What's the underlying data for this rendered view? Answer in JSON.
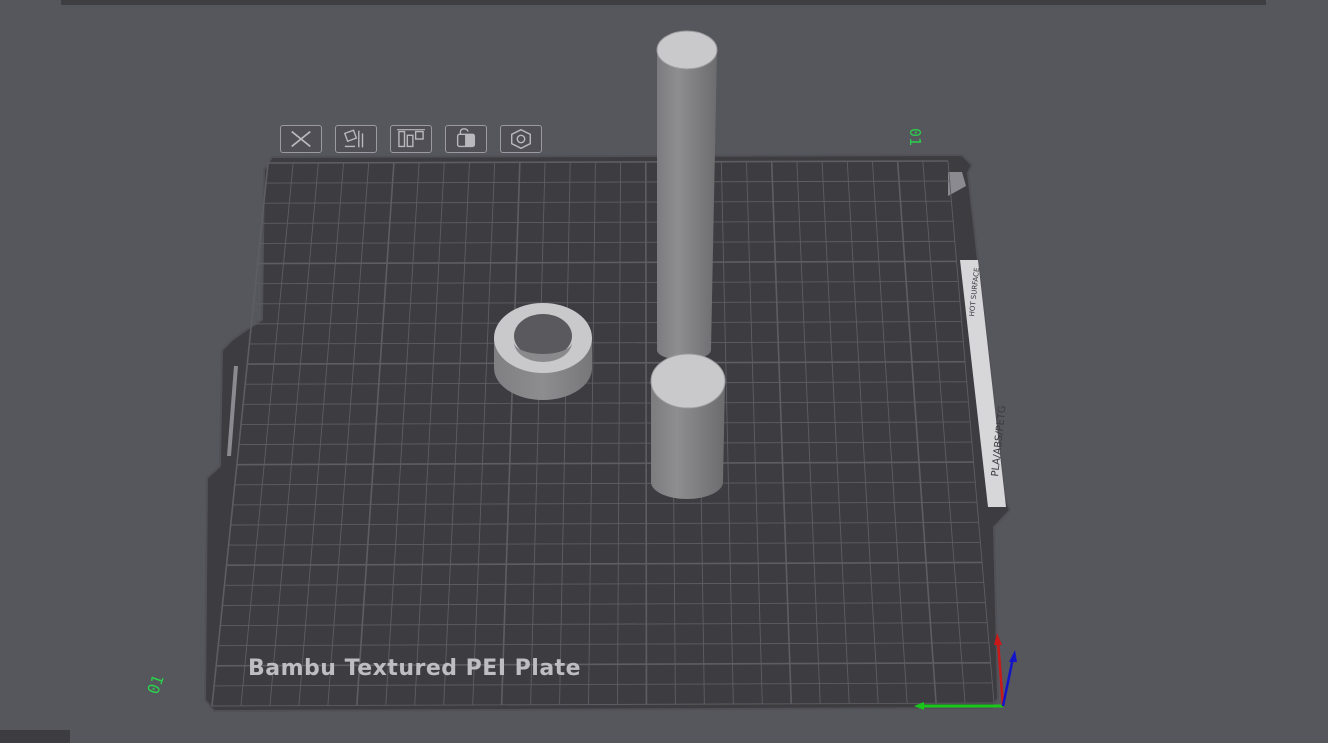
{
  "viewport": {
    "plate_name": "Bambu Textured PEI Plate",
    "plate_index": "01",
    "corner_label": "01",
    "plate_edge_labels": {
      "material": "PLA/ABS/PETG",
      "warning": "HOT SURFACE"
    }
  },
  "plate_toolbar": [
    {
      "name": "delete-all-button",
      "icon": "close-x-icon"
    },
    {
      "name": "auto-orient-button",
      "icon": "auto-orient-icon"
    },
    {
      "name": "arrange-button",
      "icon": "arrange-icon"
    },
    {
      "name": "lock-plate-button",
      "icon": "lock-icon"
    },
    {
      "name": "plate-settings-button",
      "icon": "settings-gear-icon"
    }
  ],
  "colors": {
    "background": "#56565d",
    "plate": "#3b3b40",
    "grid_line": "#5d5d63",
    "model": "#a9a9ab",
    "axis_x": "#19c61a",
    "axis_y": "#1515c8",
    "axis_z": "#c81818",
    "label_green": "#2ad04b"
  }
}
